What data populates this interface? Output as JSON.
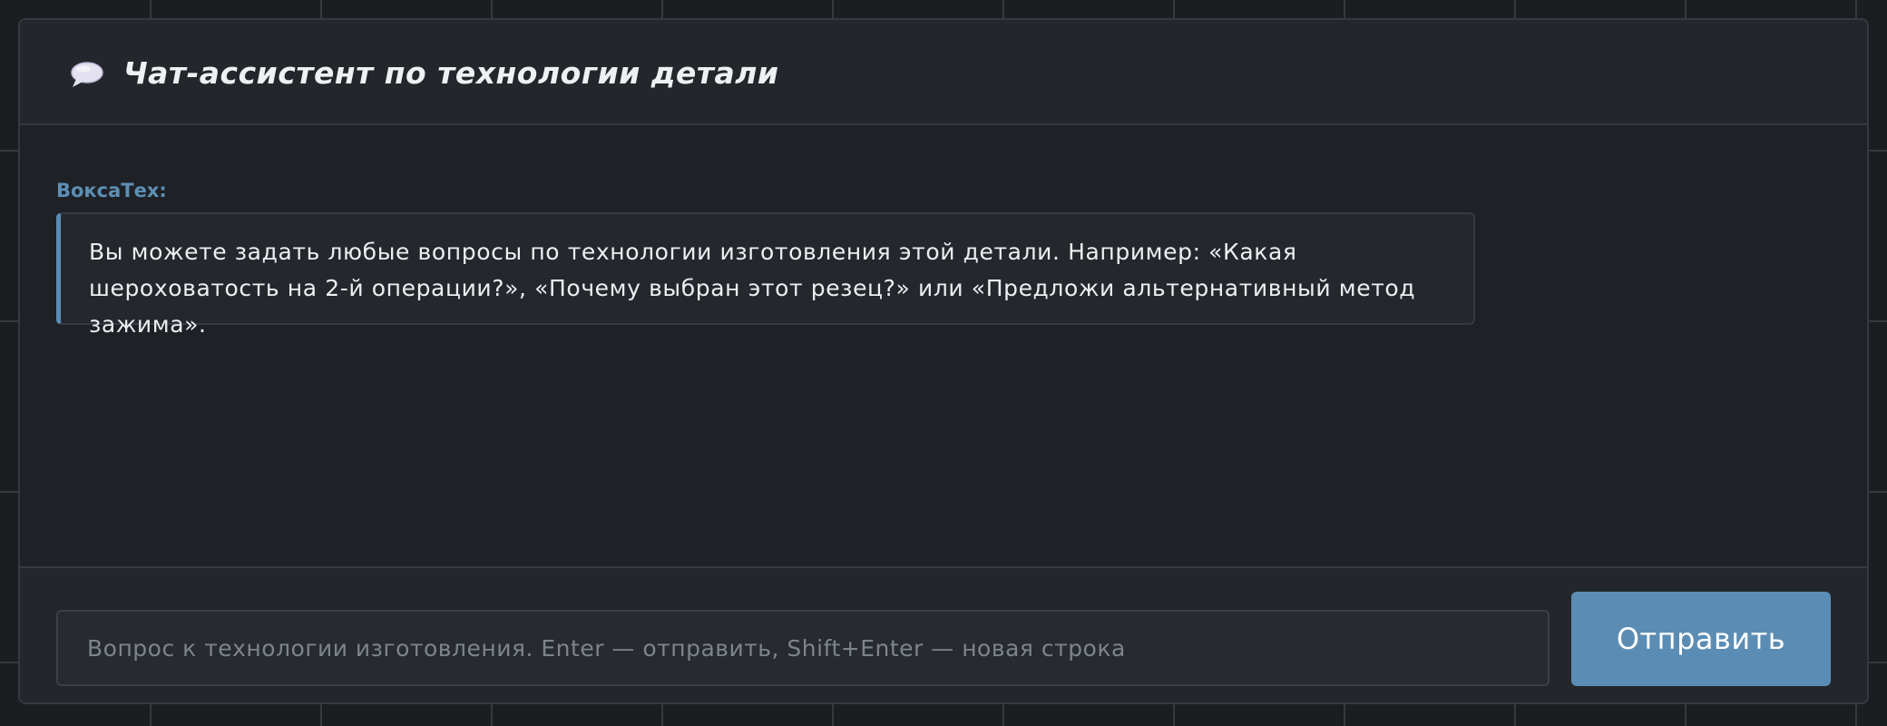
{
  "header": {
    "icon": "speech-bubble-icon",
    "title": "Чат-ассистент по технологии детали"
  },
  "messages": [
    {
      "sender": "ВоксаТех:",
      "text": "Вы можете задать любые вопросы по технологии изготовления этой детали. Например: «Какая шероховатость на 2-й операции?», «Почему выбран этот резец?» или «Предложи альтернативный метод зажима»."
    }
  ],
  "composer": {
    "value": "",
    "placeholder": "Вопрос к технологии изготовления. Enter — отправить, Shift+Enter — новая строка",
    "send_label": "Отправить"
  },
  "colors": {
    "accent": "#5b8db4",
    "sender": "#5d8fb5",
    "background": "#1b1e21",
    "panel": "#1e2125",
    "header": "#23272b"
  }
}
